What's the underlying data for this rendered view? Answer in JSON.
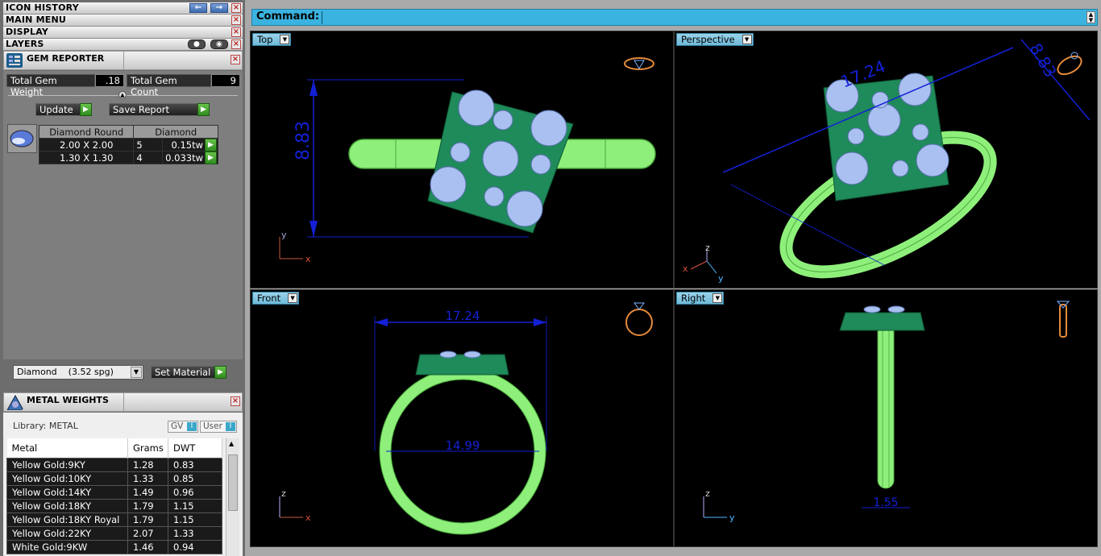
{
  "left_panel": {
    "icon_history": {
      "title": "ICON HISTORY"
    },
    "main_menu": {
      "title": "MAIN MENU"
    },
    "display": {
      "title": "DISPLAY"
    },
    "layers": {
      "title": "LAYERS"
    },
    "gem_reporter": {
      "title": "GEM REPORTER",
      "total_weight_label": "Total Gem Weight",
      "total_weight_value": ".18",
      "total_count_label": "Total Gem Count",
      "total_count_value": "9",
      "update_label": "Update",
      "save_report_label": "Save Report",
      "table_header_left": "Diamond Round",
      "table_header_right": "Diamond",
      "rows": [
        {
          "size": "2.00 X 2.00",
          "count": "5",
          "weight": "0.15tw"
        },
        {
          "size": "1.30 X 1.30",
          "count": "4",
          "weight": "0.033tw"
        }
      ],
      "material_select": "Diamond    (3.52 spg)",
      "set_material_label": "Set Material"
    },
    "metal_weights": {
      "title": "METAL WEIGHTS",
      "library_label": "Library: METAL",
      "gv_label": "GV",
      "user_label": "User",
      "columns": [
        "Metal",
        "Grams",
        "DWT"
      ],
      "rows": [
        [
          "Yellow Gold:9KY",
          "1.28",
          "0.83"
        ],
        [
          "Yellow Gold:10KY",
          "1.33",
          "0.85"
        ],
        [
          "Yellow Gold:14KY",
          "1.49",
          "0.96"
        ],
        [
          "Yellow Gold:18KY",
          "1.79",
          "1.15"
        ],
        [
          "Yellow Gold:18KY Royal",
          "1.79",
          "1.15"
        ],
        [
          "Yellow Gold:22KY",
          "2.07",
          "1.33"
        ],
        [
          "White Gold:9KW",
          "1.46",
          "0.94"
        ]
      ]
    }
  },
  "command_bar": {
    "label": "Command:"
  },
  "viewports": {
    "top": {
      "label": "Top",
      "dimension": "8.83",
      "axis1": "y",
      "axis2": "x"
    },
    "perspective": {
      "label": "Perspective",
      "dimension1": "17.24",
      "dimension2": "8.83",
      "axis_z": "z",
      "axis_x": "x",
      "axis_y": "y"
    },
    "front": {
      "label": "Front",
      "dimension_outer": "17.24",
      "dimension_inner": "14.99",
      "axis1": "z",
      "axis2": "x"
    },
    "right": {
      "label": "Right",
      "dimension": "1.55",
      "axis1": "z",
      "axis2": "y"
    }
  },
  "colors": {
    "accent_cyan": "#3bb3e0",
    "metal_green": "#8ef07a",
    "prong_green": "#1f8a5a",
    "gem_blue": "#a9c0f0",
    "dimension_blue": "#1420d6"
  }
}
